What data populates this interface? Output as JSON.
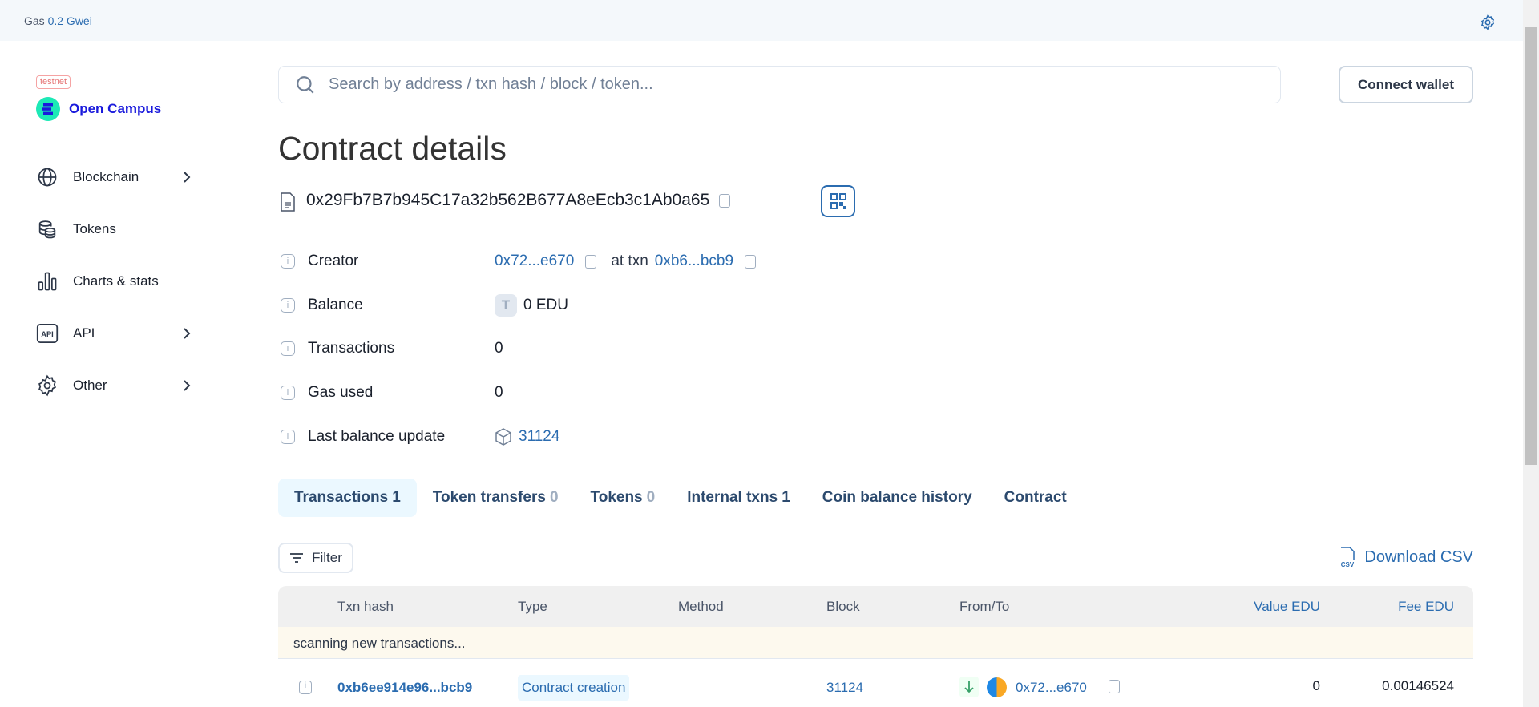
{
  "topbar": {
    "gas_label": "Gas",
    "gas_value": "0.2 Gwei"
  },
  "brand": {
    "badge": "testnet",
    "name": "Open Campus",
    "color": "#1a1adc"
  },
  "sidebar": {
    "items": [
      {
        "label": "Blockchain",
        "icon": "globe-icon",
        "chevron": true
      },
      {
        "label": "Tokens",
        "icon": "coins-icon",
        "chevron": false
      },
      {
        "label": "Charts & stats",
        "icon": "bar-chart-icon",
        "chevron": false
      },
      {
        "label": "API",
        "icon": "api-icon",
        "chevron": true
      },
      {
        "label": "Other",
        "icon": "gear-icon",
        "chevron": true
      }
    ]
  },
  "search": {
    "placeholder": "Search by address / txn hash / block / token..."
  },
  "header": {
    "connect_wallet": "Connect wallet",
    "title": "Contract details",
    "address": "0x29Fb7B7b945C17a32b562B677A8eEcb3c1Ab0a65"
  },
  "details": {
    "creator_label": "Creator",
    "creator_addr": "0x72...e670",
    "at_txn": "at txn",
    "creator_txn": "0xb6...bcb9",
    "balance_label": "Balance",
    "balance_token": "T",
    "balance_value": "0 EDU",
    "transactions_label": "Transactions",
    "transactions_value": "0",
    "gas_label": "Gas used",
    "gas_value": "0",
    "last_label": "Last balance update",
    "last_value": "31124"
  },
  "tabs": [
    {
      "label": "Transactions",
      "count": "1",
      "active": true
    },
    {
      "label": "Token transfers",
      "count": "0"
    },
    {
      "label": "Tokens",
      "count": "0"
    },
    {
      "label": "Internal txns",
      "count": "1"
    },
    {
      "label": "Coin balance history",
      "count": ""
    },
    {
      "label": "Contract",
      "count": ""
    }
  ],
  "toolbar": {
    "filter": "Filter",
    "download": "Download CSV",
    "csv_icon_text": "CSV"
  },
  "table": {
    "columns": [
      "Txn hash",
      "Type",
      "Method",
      "Block",
      "From/To",
      "Value EDU",
      "Fee EDU"
    ],
    "scanning": "scanning new transactions...",
    "rows": [
      {
        "hash": "0xb6ee914e96...bcb9",
        "type": "Contract creation",
        "method": "",
        "block": "31124",
        "direction": "in",
        "from": "0x72...e670",
        "value": "0",
        "fee": "0.00146524"
      }
    ]
  }
}
